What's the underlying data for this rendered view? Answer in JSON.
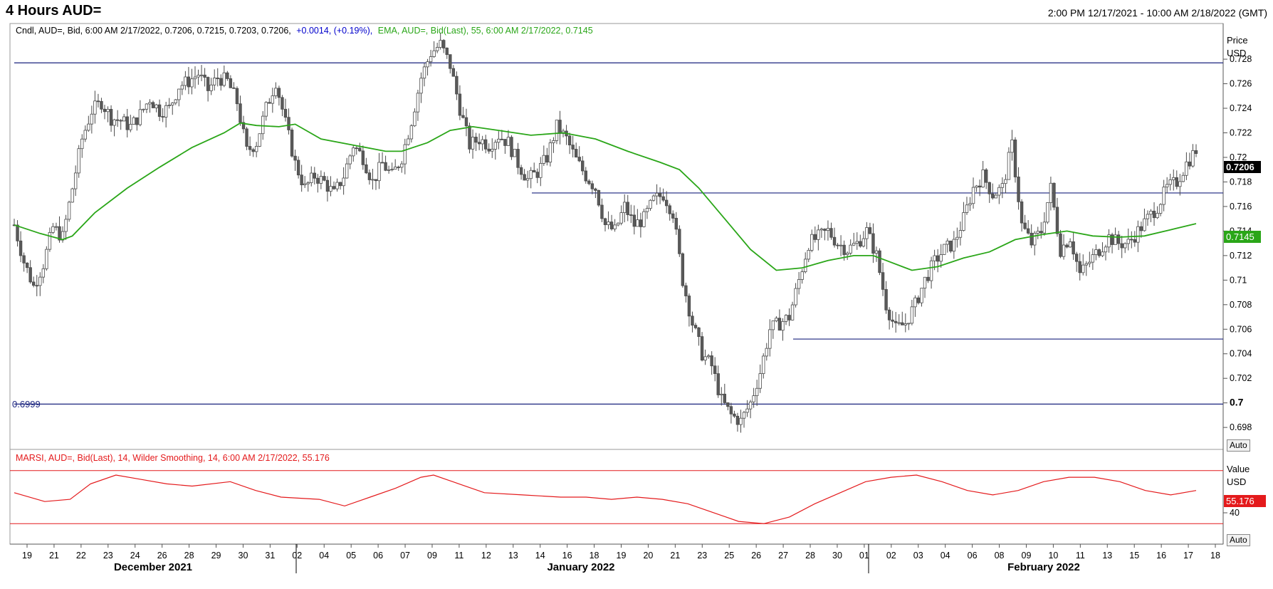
{
  "header": {
    "title": "4 Hours AUD=",
    "range": "2:00 PM 12/17/2021 - 10:00 AM 2/18/2022 (GMT)"
  },
  "price_panel": {
    "legend_cndl": "Cndl, AUD=, Bid, 6:00 AM 2/17/2022, 0.7206, 0.7215, 0.7203, 0.7206,",
    "legend_change": "+0.0014, (+0.19%),",
    "legend_ema": "EMA, AUD=, Bid(Last),  55, 6:00 AM 2/17/2022, 0.7145",
    "axis_title": "Price",
    "axis_unit": "USD",
    "auto_label": "Auto",
    "last_price_label": "0.7206",
    "ema_label": "0.7145",
    "hline_label": "0.6999",
    "colors": {
      "candle": "#5a5a5a",
      "ema": "#2aa618",
      "hline": "#1a237e",
      "last_bg": "#000000",
      "ema_bg": "#2aa618",
      "change": "#0000cc"
    }
  },
  "rsi_panel": {
    "legend": "MARSI, AUD=, Bid(Last),  14, Wilder Smoothing, 14, 6:00 AM 2/17/2022, 55.176",
    "axis_title": "Value",
    "axis_unit": "USD",
    "auto_label": "Auto",
    "value_label": "55.176",
    "tick_label": "40",
    "color": "#e41a1c"
  },
  "chart_data": [
    {
      "type": "candlestick",
      "title": "4 Hours AUD=",
      "ylabel": "Price USD",
      "ylim": [
        0.6965,
        0.7305
      ],
      "y_ticks": [
        "0.698",
        "0.7",
        "0.702",
        "0.704",
        "0.706",
        "0.708",
        "0.71",
        "0.712",
        "0.714",
        "0.716",
        "0.718",
        "0.72",
        "0.722",
        "0.724",
        "0.726",
        "0.728"
      ],
      "x_ticks": [
        "19",
        "21",
        "22",
        "23",
        "24",
        "26",
        "28",
        "29",
        "30",
        "31",
        "02",
        "04",
        "05",
        "06",
        "07",
        "09",
        "11",
        "12",
        "13",
        "14",
        "16",
        "18",
        "19",
        "20",
        "21",
        "23",
        "25",
        "26",
        "27",
        "28",
        "30",
        "01",
        "02",
        "03",
        "04",
        "06",
        "08",
        "09",
        "10",
        "11",
        "13",
        "15",
        "16",
        "17",
        "18"
      ],
      "month_labels": [
        "December 2021",
        "January 2022",
        "February 2022"
      ],
      "horizontal_lines": [
        0.7277,
        0.7171,
        0.7052,
        0.6999
      ],
      "close_path": [
        [
          0,
          0.7145
        ],
        [
          3,
          0.7115
        ],
        [
          6,
          0.7095
        ],
        [
          9,
          0.7113
        ],
        [
          12,
          0.7143
        ],
        [
          15,
          0.7135
        ],
        [
          18,
          0.7175
        ],
        [
          21,
          0.7215
        ],
        [
          24,
          0.7238
        ],
        [
          27,
          0.7245
        ],
        [
          30,
          0.7232
        ],
        [
          33,
          0.723
        ],
        [
          36,
          0.7225
        ],
        [
          39,
          0.7235
        ],
        [
          42,
          0.7248
        ],
        [
          45,
          0.7238
        ],
        [
          48,
          0.724
        ],
        [
          51,
          0.7258
        ],
        [
          54,
          0.7262
        ],
        [
          57,
          0.7268
        ],
        [
          60,
          0.7255
        ],
        [
          63,
          0.7265
        ],
        [
          66,
          0.7262
        ],
        [
          69,
          0.7245
        ],
        [
          72,
          0.7205
        ],
        [
          75,
          0.7212
        ],
        [
          78,
          0.724
        ],
        [
          81,
          0.7262
        ],
        [
          84,
          0.7228
        ],
        [
          87,
          0.7195
        ],
        [
          90,
          0.7175
        ],
        [
          93,
          0.7185
        ],
        [
          96,
          0.718
        ],
        [
          99,
          0.717
        ],
        [
          102,
          0.7185
        ],
        [
          105,
          0.721
        ],
        [
          108,
          0.72
        ],
        [
          111,
          0.718
        ],
        [
          114,
          0.7195
        ],
        [
          117,
          0.7185
        ],
        [
          120,
          0.72
        ],
        [
          123,
          0.723
        ],
        [
          126,
          0.7265
        ],
        [
          129,
          0.7285
        ],
        [
          132,
          0.7292
        ],
        [
          135,
          0.7275
        ],
        [
          138,
          0.724
        ],
        [
          141,
          0.721
        ],
        [
          144,
          0.7215
        ],
        [
          147,
          0.721
        ],
        [
          150,
          0.7218
        ],
        [
          153,
          0.7212
        ],
        [
          156,
          0.7195
        ],
        [
          159,
          0.7182
        ],
        [
          162,
          0.7188
        ],
        [
          165,
          0.72
        ],
        [
          168,
          0.7225
        ],
        [
          171,
          0.7215
        ],
        [
          174,
          0.7198
        ],
        [
          177,
          0.7185
        ],
        [
          180,
          0.7175
        ],
        [
          183,
          0.7145
        ],
        [
          186,
          0.714
        ],
        [
          189,
          0.716
        ],
        [
          192,
          0.7145
        ],
        [
          195,
          0.715
        ],
        [
          198,
          0.7165
        ],
        [
          201,
          0.717
        ],
        [
          204,
          0.7155
        ],
        [
          207,
          0.71
        ],
        [
          210,
          0.7065
        ],
        [
          213,
          0.704
        ],
        [
          216,
          0.703
        ],
        [
          219,
          0.7002
        ],
        [
          222,
          0.699
        ],
        [
          225,
          0.6985
        ],
        [
          228,
          0.7
        ],
        [
          231,
          0.7025
        ],
        [
          234,
          0.706
        ],
        [
          237,
          0.7065
        ],
        [
          240,
          0.707
        ],
        [
          243,
          0.71
        ],
        [
          246,
          0.713
        ],
        [
          249,
          0.7135
        ],
        [
          252,
          0.714
        ],
        [
          255,
          0.713
        ],
        [
          258,
          0.7125
        ],
        [
          261,
          0.713
        ],
        [
          264,
          0.714
        ],
        [
          267,
          0.712
        ],
        [
          270,
          0.708
        ],
        [
          273,
          0.706
        ],
        [
          276,
          0.7065
        ],
        [
          279,
          0.708
        ],
        [
          282,
          0.71
        ],
        [
          285,
          0.7115
        ],
        [
          288,
          0.7125
        ],
        [
          291,
          0.713
        ],
        [
          294,
          0.715
        ],
        [
          297,
          0.7175
        ],
        [
          300,
          0.7185
        ],
        [
          303,
          0.717
        ],
        [
          306,
          0.7175
        ],
        [
          309,
          0.721
        ],
        [
          312,
          0.7145
        ],
        [
          315,
          0.713
        ],
        [
          318,
          0.714
        ],
        [
          321,
          0.7175
        ],
        [
          324,
          0.7125
        ],
        [
          327,
          0.7135
        ],
        [
          330,
          0.7105
        ],
        [
          333,
          0.7115
        ],
        [
          336,
          0.7125
        ],
        [
          339,
          0.7135
        ],
        [
          342,
          0.713
        ],
        [
          345,
          0.713
        ],
        [
          348,
          0.714
        ],
        [
          351,
          0.715
        ],
        [
          354,
          0.716
        ],
        [
          357,
          0.7175
        ],
        [
          360,
          0.718
        ],
        [
          363,
          0.7195
        ],
        [
          366,
          0.7206
        ]
      ],
      "ema_55": [
        [
          0,
          0.7145
        ],
        [
          8,
          0.7138
        ],
        [
          15,
          0.7133
        ],
        [
          18,
          0.7136
        ],
        [
          25,
          0.7155
        ],
        [
          35,
          0.7175
        ],
        [
          45,
          0.7192
        ],
        [
          55,
          0.7208
        ],
        [
          65,
          0.722
        ],
        [
          70,
          0.7228
        ],
        [
          75,
          0.7226
        ],
        [
          82,
          0.7225
        ],
        [
          87,
          0.7227
        ],
        [
          95,
          0.7215
        ],
        [
          105,
          0.721
        ],
        [
          115,
          0.7205
        ],
        [
          120,
          0.7205
        ],
        [
          128,
          0.7212
        ],
        [
          135,
          0.7222
        ],
        [
          142,
          0.7225
        ],
        [
          150,
          0.7222
        ],
        [
          160,
          0.7218
        ],
        [
          170,
          0.722
        ],
        [
          180,
          0.7215
        ],
        [
          190,
          0.7205
        ],
        [
          200,
          0.7196
        ],
        [
          206,
          0.719
        ],
        [
          212,
          0.7175
        ],
        [
          220,
          0.715
        ],
        [
          228,
          0.7125
        ],
        [
          236,
          0.7108
        ],
        [
          244,
          0.711
        ],
        [
          252,
          0.7116
        ],
        [
          260,
          0.712
        ],
        [
          266,
          0.712
        ],
        [
          270,
          0.7116
        ],
        [
          278,
          0.7108
        ],
        [
          286,
          0.7111
        ],
        [
          294,
          0.7118
        ],
        [
          302,
          0.7123
        ],
        [
          310,
          0.7133
        ],
        [
          318,
          0.7137
        ],
        [
          326,
          0.714
        ],
        [
          334,
          0.7136
        ],
        [
          342,
          0.7135
        ],
        [
          350,
          0.7136
        ],
        [
          358,
          0.7141
        ],
        [
          366,
          0.7146
        ]
      ]
    },
    {
      "type": "line",
      "title": "MARSI, AUD=, Bid(Last),  14, Wilder Smoothing, 14",
      "ylabel": "Value USD",
      "ylim": [
        30,
        70
      ],
      "bands": [
        62,
        38
      ],
      "values": [
        [
          0,
          52
        ],
        [
          12,
          48
        ],
        [
          22,
          49
        ],
        [
          30,
          56
        ],
        [
          40,
          60
        ],
        [
          50,
          58
        ],
        [
          60,
          56
        ],
        [
          70,
          55
        ],
        [
          85,
          57
        ],
        [
          95,
          53
        ],
        [
          105,
          50
        ],
        [
          120,
          49
        ],
        [
          130,
          46
        ],
        [
          140,
          50
        ],
        [
          150,
          54
        ],
        [
          160,
          59
        ],
        [
          165,
          60
        ],
        [
          175,
          56
        ],
        [
          185,
          52
        ],
        [
          200,
          51
        ],
        [
          215,
          50
        ],
        [
          225,
          50
        ],
        [
          235,
          49
        ],
        [
          245,
          50
        ],
        [
          255,
          49
        ],
        [
          265,
          47
        ],
        [
          275,
          43
        ],
        [
          285,
          39
        ],
        [
          295,
          38
        ],
        [
          305,
          41
        ],
        [
          315,
          47
        ],
        [
          325,
          52
        ],
        [
          335,
          57
        ],
        [
          345,
          59
        ],
        [
          355,
          60
        ],
        [
          365,
          57
        ],
        [
          375,
          53
        ],
        [
          385,
          51
        ],
        [
          395,
          53
        ],
        [
          405,
          57
        ],
        [
          415,
          59
        ],
        [
          425,
          59
        ],
        [
          435,
          57
        ],
        [
          445,
          53
        ],
        [
          455,
          51
        ],
        [
          465,
          53
        ]
      ],
      "last_value": 55.176
    }
  ]
}
